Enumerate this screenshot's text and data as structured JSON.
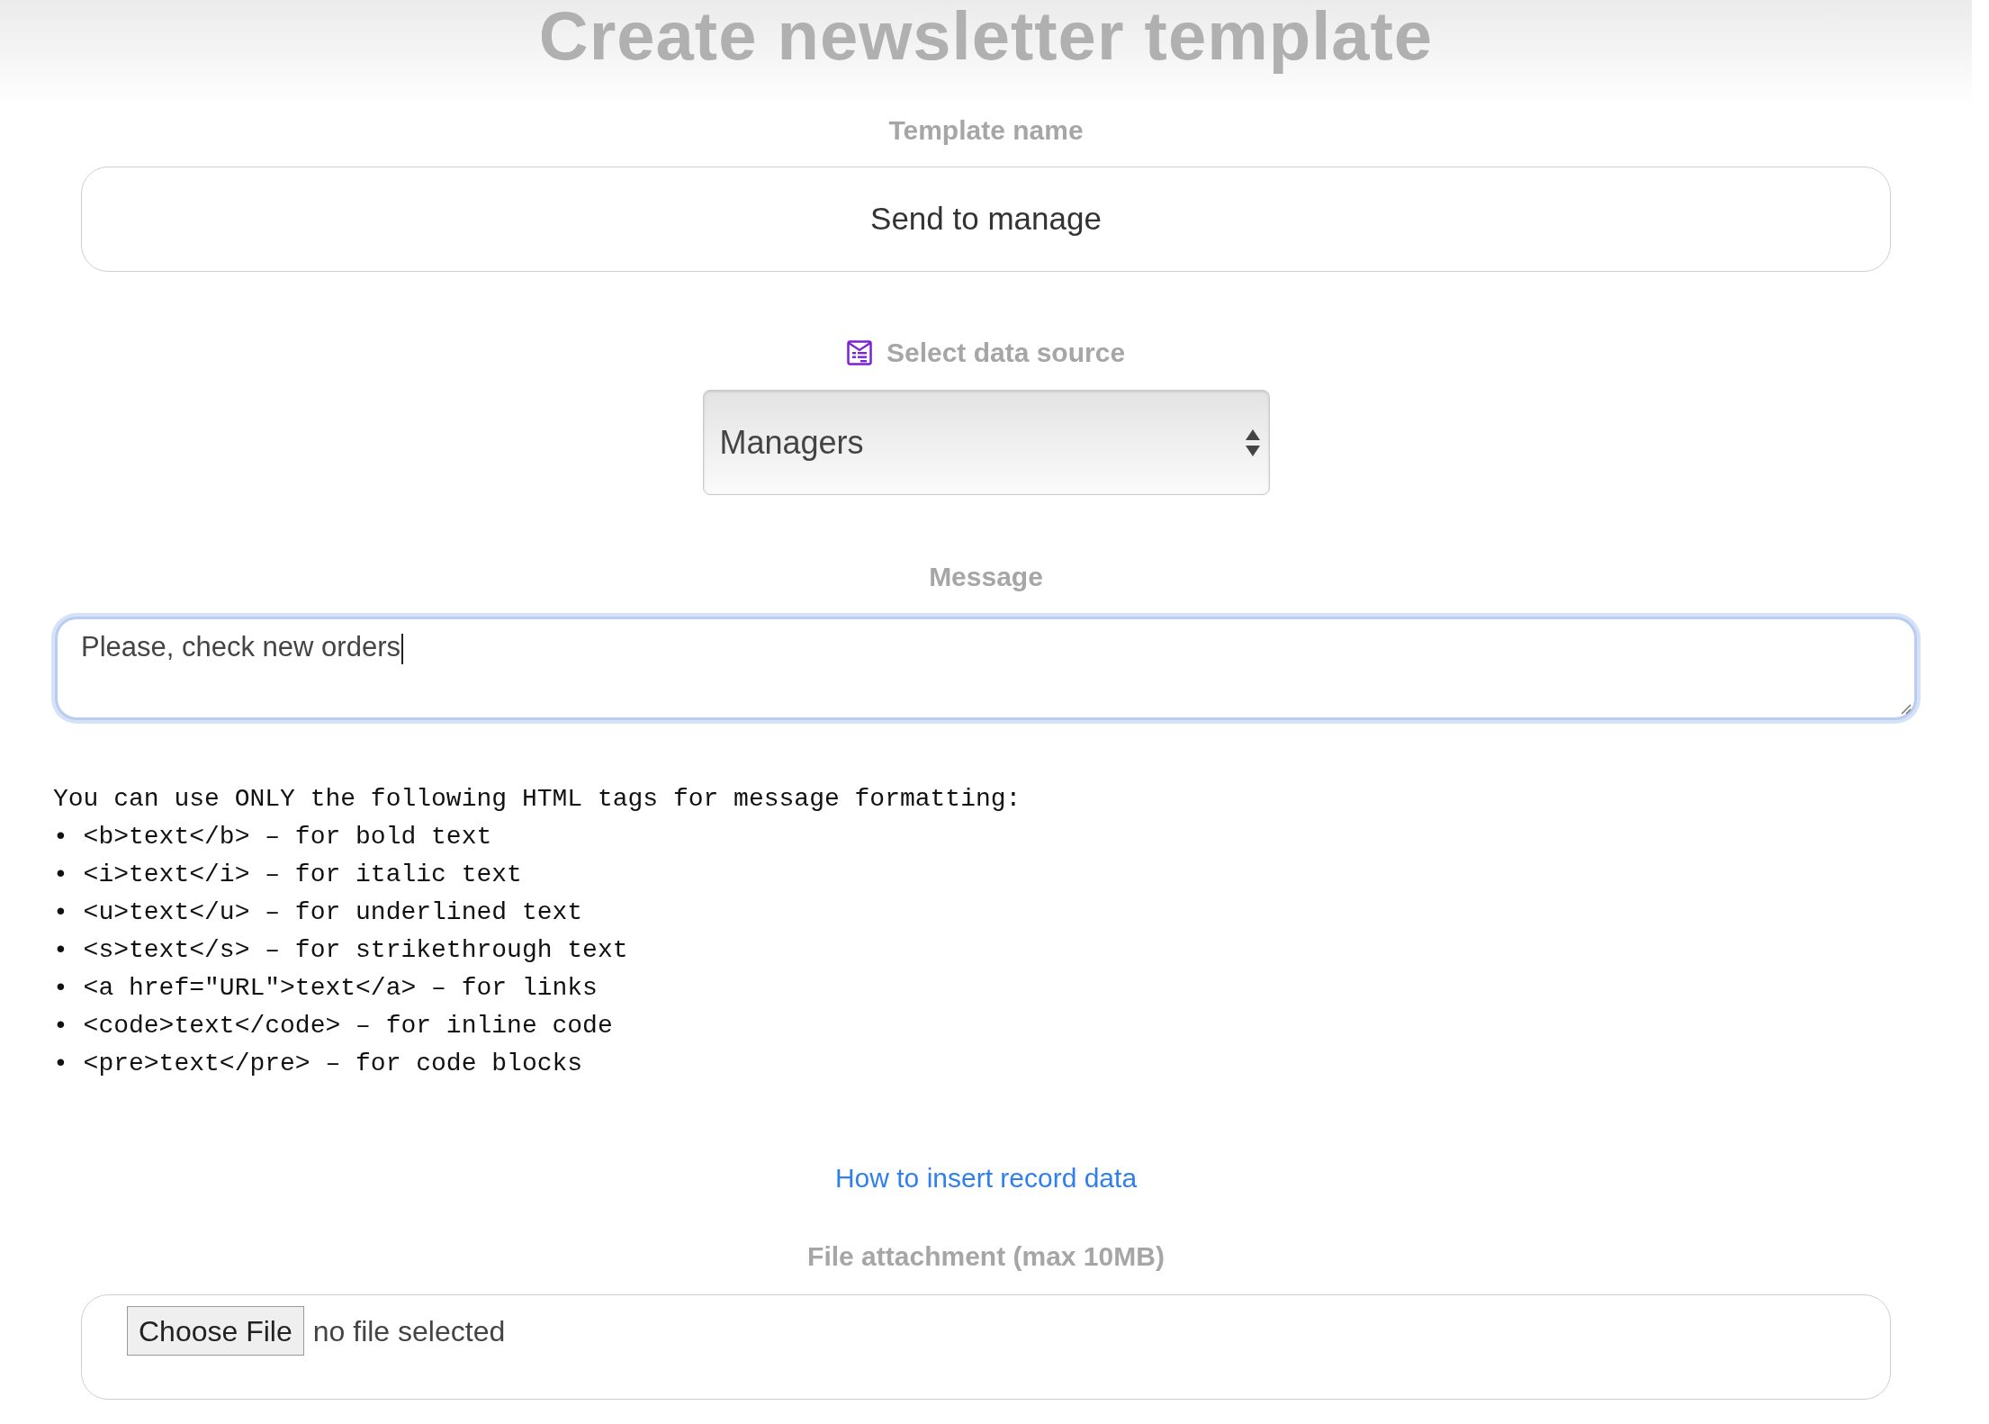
{
  "title": "Create newsletter template",
  "template_name": {
    "label": "Template name",
    "value": "Send to manage"
  },
  "data_source": {
    "label": "Select data source",
    "value": "Managers"
  },
  "message": {
    "label": "Message",
    "value": "Please, check new orders",
    "focused": true
  },
  "formatting_help": {
    "intro": "You can use ONLY the following HTML tags for message formatting:",
    "items": [
      "• <b>text</b> – for bold text",
      "• <i>text</i> – for italic text",
      "• <u>text</u> – for underlined text",
      "• <s>text</s> – for strikethrough text",
      "• <a href=\"URL\">text</a> – for links",
      "• <code>text</code> – for inline code",
      "• <pre>text</pre> – for code blocks"
    ]
  },
  "help_link": "How to insert record data",
  "attachment": {
    "label": "File attachment (max 10MB)",
    "button": "Choose File",
    "status": "no file selected"
  }
}
